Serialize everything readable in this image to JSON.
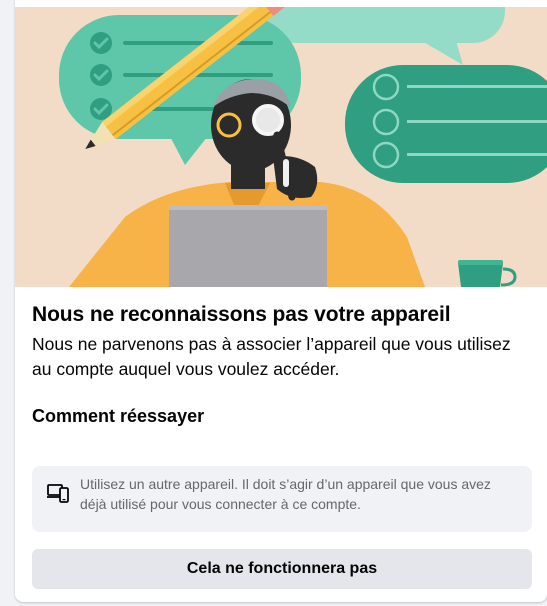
{
  "dialog": {
    "title": "Nous ne reconnaissons pas votre appareil",
    "description": "Nous ne parvenons pas à associer l’appareil que vous utilisez au compte auquel vous voulez accéder.",
    "retry_heading": "Comment réessayer",
    "tip": {
      "icon": "devices-icon",
      "text": "Utilisez un autre appareil. Il doit s’agir d’un appareil que vous avez déjà utilisé pour vous connecter à ce compte."
    },
    "action_button_label": "Cela ne fonctionnera pas"
  },
  "illustration": {
    "icons": [
      "checklist-bubble",
      "pencil",
      "person-with-magnifier",
      "laptop",
      "list-bubble",
      "coffee-cup"
    ]
  },
  "colors": {
    "illustration_background": "#f2dcc8",
    "bubble_green_light": "#5fc7a9",
    "bubble_green_dark": "#2f9e81",
    "shirt_yellow": "#f7b248",
    "pencil_yellow": "#f6c142",
    "laptop_gray": "#a8a8ac",
    "button_background": "#e4e6eb",
    "tip_background": "#f0f2f5",
    "secondary_text": "#65676b"
  }
}
